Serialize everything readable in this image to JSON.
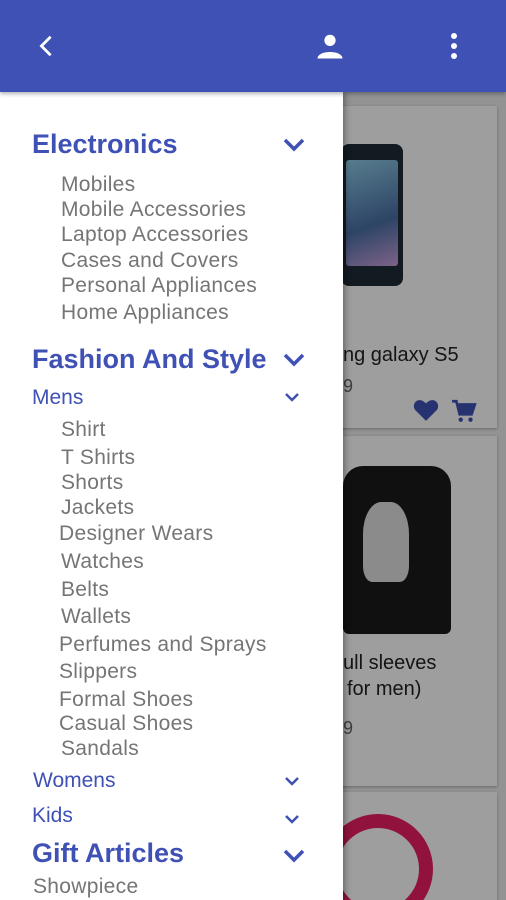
{
  "appbar": {
    "background": "#3f51b5",
    "icons": [
      "back-arrow-icon",
      "account-icon",
      "more-vertical-icon"
    ]
  },
  "products": [
    {
      "name": "ng galaxy S5",
      "price": "9"
    },
    {
      "name_line1": "ull sleeves",
      "name_line2": "for men)",
      "price": "9"
    },
    {
      "name": "",
      "price": ""
    }
  ],
  "drawer": {
    "electronics": {
      "label": "Electronics",
      "items": [
        "Mobiles",
        "Mobile Accessories",
        "Laptop Accessories",
        "Cases and Covers",
        "Personal Appliances",
        "Home Appliances"
      ]
    },
    "fashion": {
      "label": "Fashion And Style",
      "mens": {
        "label": "Mens",
        "items": [
          "Shirt",
          "T Shirts",
          "Shorts",
          "Jackets",
          "Designer Wears",
          "Watches",
          "Belts",
          "Wallets",
          "Perfumes and Sprays",
          "Slippers",
          "Formal Shoes",
          "Casual Shoes",
          "Sandals"
        ]
      },
      "womens": {
        "label": "Womens"
      },
      "kids": {
        "label": "Kids"
      }
    },
    "gifts": {
      "label": "Gift Articles",
      "items": [
        "Showpiece"
      ]
    }
  },
  "colors": {
    "accent": "#3f51b5",
    "muted_text": "#757575"
  }
}
